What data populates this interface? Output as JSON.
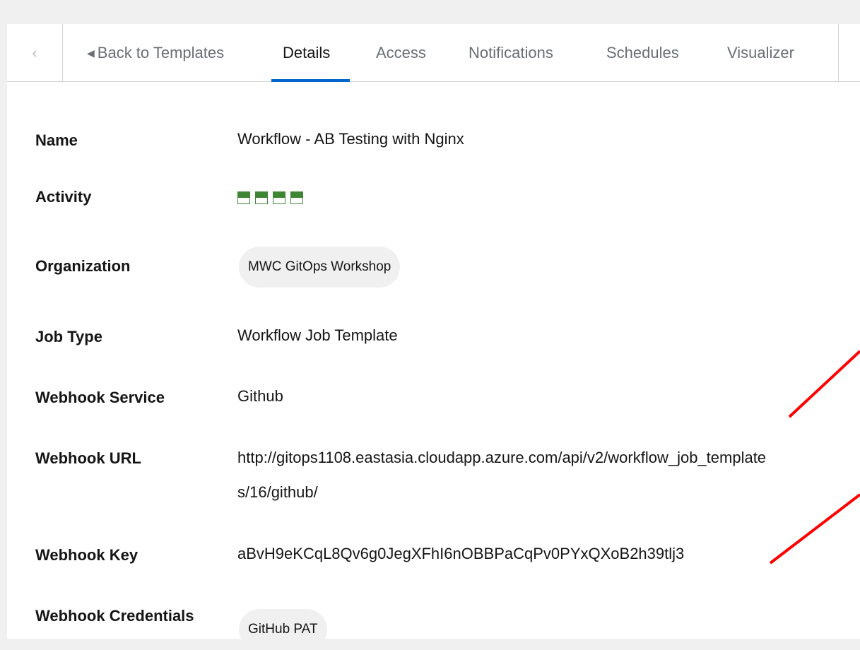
{
  "tabs": {
    "back_label": "Back to Templates",
    "items": [
      "Details",
      "Access",
      "Notifications",
      "Schedules",
      "Visualizer"
    ],
    "active": "Details"
  },
  "details": {
    "name_label": "Name",
    "name_value": "Workflow - AB Testing with Nginx",
    "activity_label": "Activity",
    "activity_jobs": [
      "success",
      "success",
      "success",
      "success"
    ],
    "organization_label": "Organization",
    "organization_value": "MWC GitOps Workshop",
    "job_type_label": "Job Type",
    "job_type_value": "Workflow Job Template",
    "webhook_service_label": "Webhook Service",
    "webhook_service_value": "Github",
    "webhook_url_label": "Webhook URL",
    "webhook_url_line1": "http://gitops1108.eastasia.cloudapp.azure.com/api/v2/workflow_job_template",
    "webhook_url_line2": "s/16/github/",
    "webhook_key_label": "Webhook Key",
    "webhook_key_value": "aBvH9eKCqL8Qv6g0JegXFhI6nOBBPaCqPv0PYxQXoB2h39tlj3",
    "webhook_credentials_label": "Webhook Credentials",
    "webhook_credentials_value": "GitHub PAT"
  },
  "colors": {
    "tab_active_underline": "#0066cc",
    "activity_success": "#3e8635",
    "annotation_line": "#ff0000"
  },
  "icons": {
    "scroll_left": "chevron-left-icon",
    "back": "caret-left-icon"
  }
}
